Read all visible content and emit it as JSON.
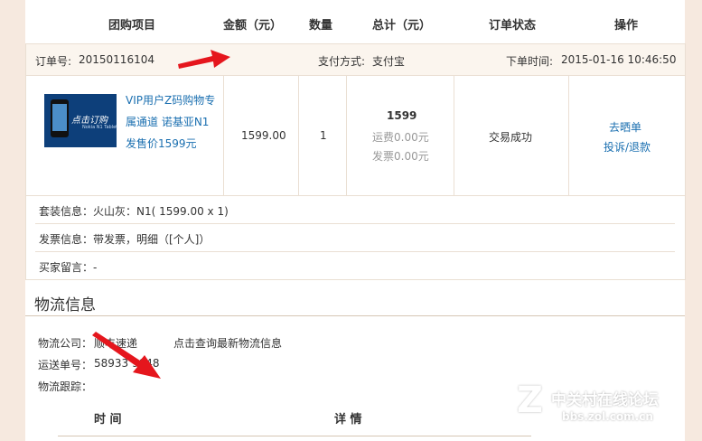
{
  "table_header": {
    "item": "团购项目",
    "amount": "金额（元）",
    "quantity": "数量",
    "total": "总计（元）",
    "status": "订单状态",
    "action": "操作"
  },
  "order": {
    "order_no_label": "订单号:",
    "order_no_value": "20150116104",
    "pay_method_label": "支付方式:",
    "pay_method_value": "支付宝",
    "order_time_label": "下单时间:",
    "order_time_value": "2015-01-16 10:46:50",
    "product": {
      "thumb_brand": "点击订购",
      "thumb_sub": "Nokia N1 Tablet",
      "name": "VIP用户Z码购物专属通道 诺基亚N1发售价1599元",
      "price": "1599.00",
      "quantity": "1",
      "total": "1599",
      "shipping_fee": "运费0.00元",
      "invoice_fee": "发票0.00元",
      "status": "交易成功",
      "action_review": "去晒单",
      "action_complaint": "投诉/退款"
    },
    "set_info": "套装信息：火山灰：N1( 1599.00 x 1)",
    "invoice_info": "发票信息：带发票，明细（[个人]）",
    "buyer_message": "买家留言：-"
  },
  "logistics": {
    "title": "物流信息",
    "company_label": "物流公司：",
    "company_value": "顺丰速递",
    "query_link": "点击查询最新物流信息",
    "tracking_label": "运送单号：",
    "tracking_value": "58933 9048",
    "trace_label": "物流跟踪：",
    "col_time": "时  间",
    "col_detail": "详  情"
  },
  "watermark": {
    "logo_letter": "Z",
    "line1": "中关村在线论坛",
    "line2": "bbs.zol.com.cn"
  },
  "colors": {
    "link": "#1a6fb0",
    "arrow": "#e5161d",
    "page_bg": "#f6e9df",
    "border": "#eadfd3"
  }
}
